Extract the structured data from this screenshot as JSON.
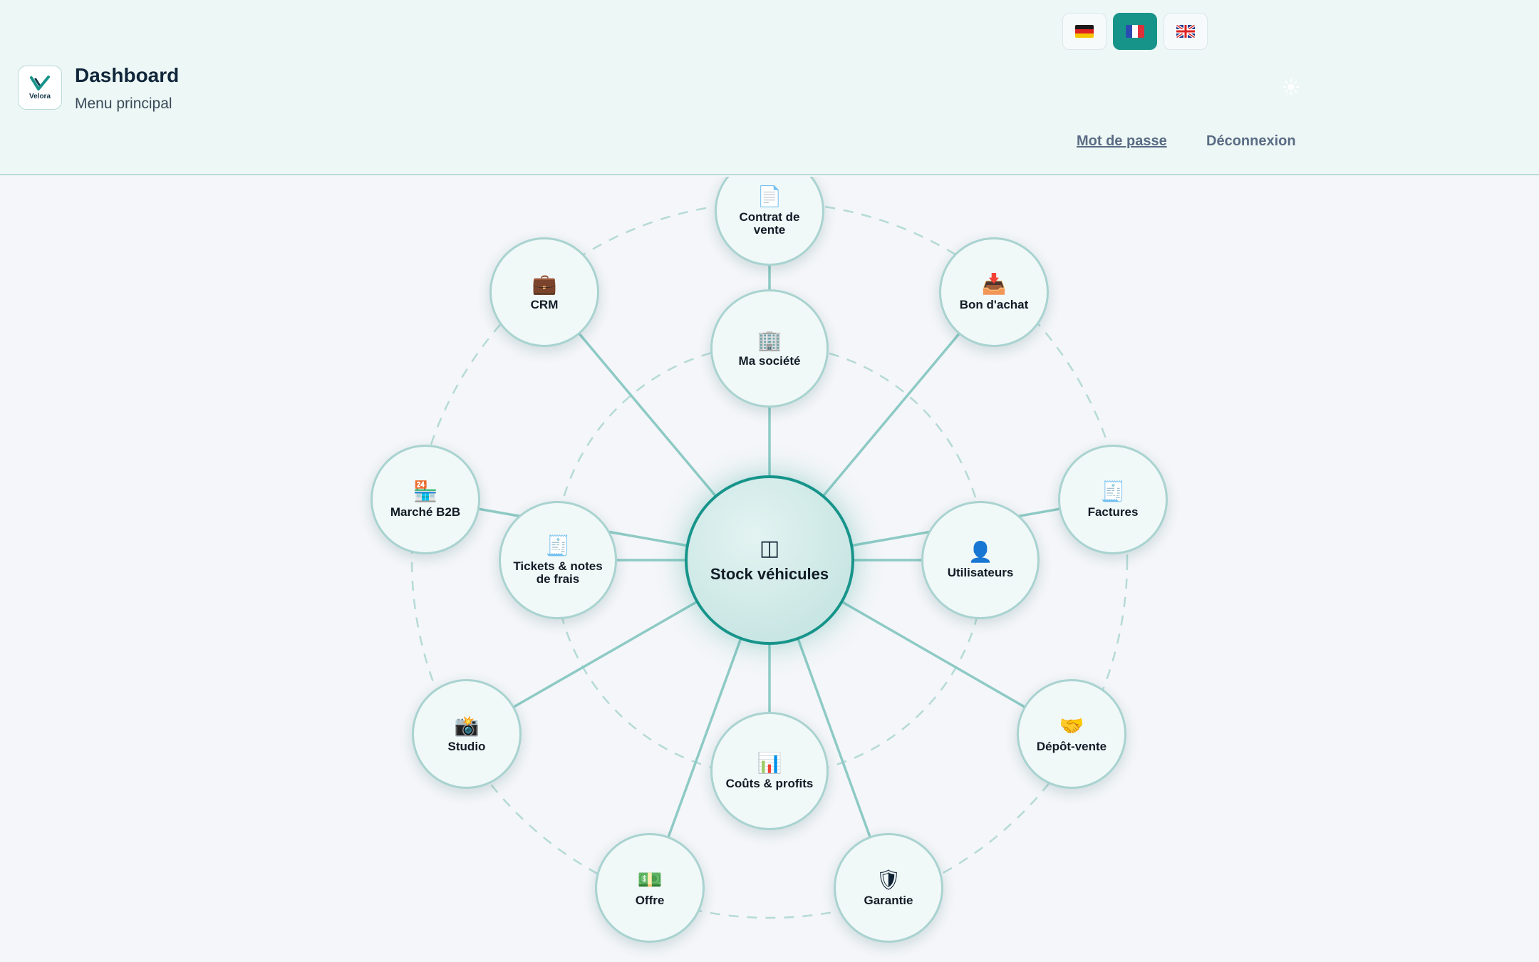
{
  "header": {
    "title": "Dashboard",
    "subtitle": "Menu principal",
    "logo_text": "Velora",
    "languages": [
      {
        "code": "de",
        "icon": "flag-germany",
        "active": false
      },
      {
        "code": "fr",
        "icon": "flag-france",
        "active": true
      },
      {
        "code": "en",
        "icon": "flag-uk",
        "active": false
      }
    ],
    "theme_icon": "sun-icon",
    "password_link": "Mot de passe",
    "logout_link": "Déconnexion"
  },
  "colors": {
    "accent": "#17948a",
    "header_bg": "#edf7f5",
    "page_bg": "#f4f6f9",
    "node_border": "#a9d3d0"
  },
  "hub": {
    "center": {
      "label": "Stock véhicules",
      "icon": "◫"
    },
    "nodes": [
      {
        "id": "contrat",
        "label": "Contrat de vente",
        "icon": "📄"
      },
      {
        "id": "crm",
        "label": "CRM",
        "icon": "💼"
      },
      {
        "id": "bon",
        "label": "Bon d'achat",
        "icon": "📥"
      },
      {
        "id": "societe",
        "label": "Ma société",
        "icon": "🏢"
      },
      {
        "id": "b2b",
        "label": "Marché B2B",
        "icon": "🏪"
      },
      {
        "id": "factures",
        "label": "Factures",
        "icon": "🧾"
      },
      {
        "id": "tickets",
        "label": "Tickets & notes de frais",
        "icon": "🧾"
      },
      {
        "id": "users",
        "label": "Utilisateurs",
        "icon": "👤"
      },
      {
        "id": "studio",
        "label": "Studio",
        "icon": "📸"
      },
      {
        "id": "depot",
        "label": "Dépôt-vente",
        "icon": "🤝"
      },
      {
        "id": "couts",
        "label": "Coûts & profits",
        "icon": "📊"
      },
      {
        "id": "offre",
        "label": "Offre",
        "icon": "💵"
      },
      {
        "id": "garantie",
        "label": "Garantie",
        "icon": "🛡"
      }
    ]
  }
}
